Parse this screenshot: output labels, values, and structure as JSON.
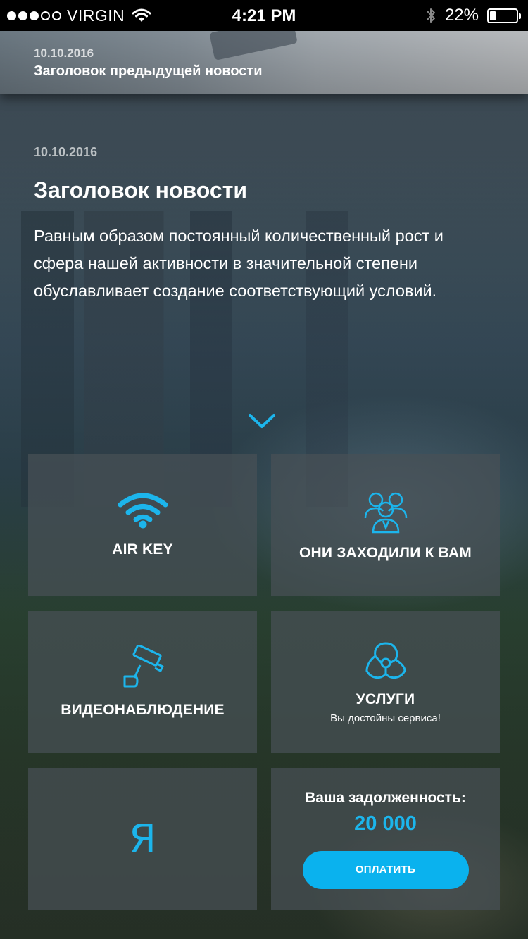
{
  "status_bar": {
    "carrier": "VIRGIN",
    "time": "4:21 PM",
    "battery_percent": "22%",
    "battery_level": 0.22,
    "signal_filled": 3,
    "signal_total": 5
  },
  "prev_news": {
    "date": "10.10.2016",
    "title": "Заголовок предыдущей новости"
  },
  "news": {
    "date": "10.10.2016",
    "title": "Заголовок новости",
    "body_lines": [
      "Равным образом постоянный количественный рост и",
      "сфера нашей активности в значительной степени",
      "обуславливает создание соответствующий условий."
    ]
  },
  "tiles": {
    "air_key": {
      "label": "AIR KEY",
      "icon": "wifi-icon"
    },
    "visitors": {
      "label": "ОНИ ЗАХОДИЛИ К ВАМ",
      "icon": "people-icon"
    },
    "video": {
      "label": "ВИДЕОНАБЛЮДЕНИЕ",
      "icon": "camera-icon"
    },
    "services": {
      "label": "УСЛУГИ",
      "subtitle": "Вы достойны сервиса!",
      "icon": "services-icon"
    },
    "yandex": {
      "glyph": "Я",
      "icon": "yandex-icon"
    },
    "debt": {
      "label": "Ваша задолженность:",
      "value": "20 000",
      "button_label": "ОПЛАТИТЬ"
    }
  },
  "colors": {
    "accent": "#1cb5ec",
    "button": "#0ab2ee",
    "tile_bg": "rgba(72,80,86,0.72)"
  }
}
